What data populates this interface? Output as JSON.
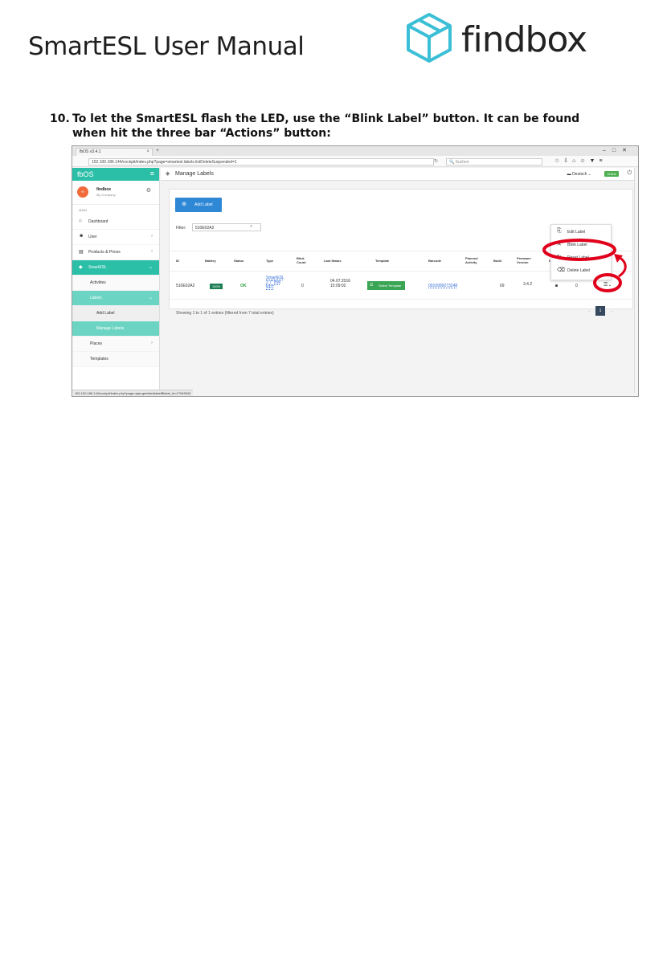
{
  "document": {
    "title": "SmartESL User Manual",
    "logo_text": "findbox",
    "step_number": "10.",
    "step_text": "To let the SmartESL flash the LED, use the “Blink Label” button. It can be found when hit the three bar “Actions” button:"
  },
  "browser": {
    "tab_title": "fbOS v3.4.1",
    "url": "152.100.186.144/cockpit/index.php?page=smartesl.labels.listDeleteSuspended=1",
    "search_placeholder": "Suchen",
    "status_url": "152.100.186.144/cockpit/index.php?page=ajax.getdirectlabelBlabel_id=17949042"
  },
  "sidebar": {
    "brand": "fbOS",
    "profile_name": "findbox",
    "profile_company": "My Company",
    "section_head": "MAIN",
    "items": [
      {
        "label": "Dashboard"
      },
      {
        "label": "User"
      },
      {
        "label": "Products & Prices"
      },
      {
        "label": "SmartESL"
      },
      {
        "label": "Activities"
      },
      {
        "label": "Labels"
      },
      {
        "label": "Add Label"
      },
      {
        "label": "Manage Labels"
      },
      {
        "label": "Places"
      },
      {
        "label": "Templates"
      }
    ]
  },
  "main": {
    "page_title": "Manage Labels",
    "language": "Deutsch",
    "online_badge": "Online",
    "add_button": "Add Label",
    "filter_label": "Filter:",
    "filter_value": "510E02A2",
    "columns": [
      "ID",
      "Battery",
      "Status",
      "Type",
      "Blink Count",
      "Last Status",
      "Template",
      "Barcode",
      "Planned Activity",
      "Build",
      "Firmware Version",
      "Ni"
    ],
    "row": {
      "id": "510E02A2",
      "battery": "100%",
      "status": "OK",
      "type": "SmartESL 2.7\" BW NFC",
      "blink_count": "0",
      "last_status": "04.07.2016 15:09:02",
      "template": "Select Template",
      "barcode": "0010999273248",
      "build": "69",
      "firmware": "3.4.2",
      "count": "0"
    },
    "footer": "Showing 1 to 1 of 1 entries (filtered from 7 total entries)",
    "page_current": "1",
    "page_prev": "←",
    "page_next": "→"
  },
  "actions_menu": {
    "items": [
      {
        "label": "Edit Label"
      },
      {
        "label": "Blink Label"
      },
      {
        "label": "Reset Label"
      },
      {
        "label": "Delete Label"
      }
    ]
  },
  "colors": {
    "brand": "#2cbfa8",
    "primary": "#2f88d6",
    "success": "#3aa655",
    "highlight": "#e0001b"
  }
}
